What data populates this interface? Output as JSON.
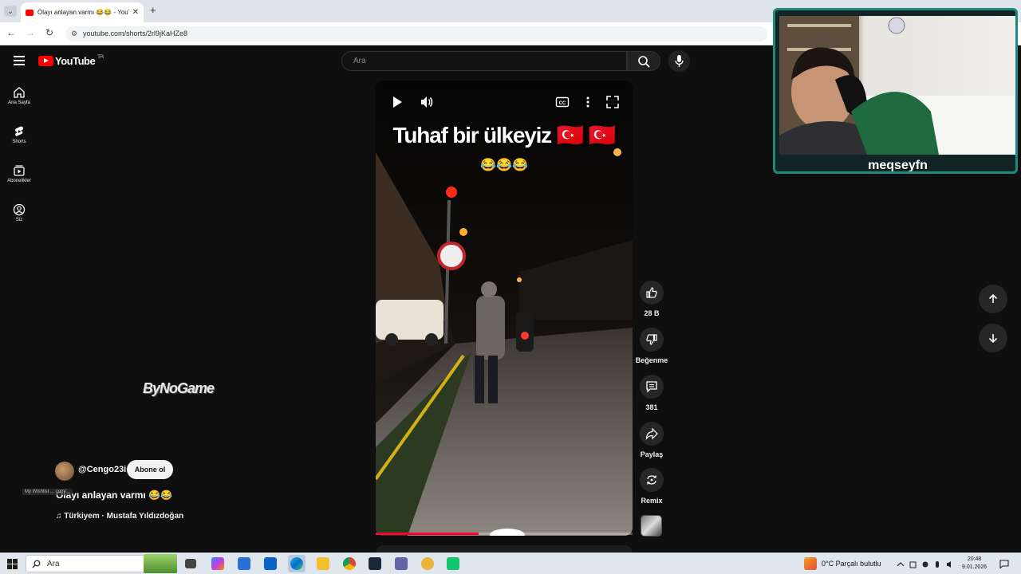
{
  "browser": {
    "tab_title": "Olayı anlayan varmı 😂😂 - YouTube",
    "url": "youtube.com/shorts/2rl9jKaHZe8",
    "new_tab": "+",
    "close": "✕",
    "tab_menu": "⌄"
  },
  "youtube": {
    "logo_text": "YouTube",
    "country_code": "TR",
    "search_placeholder": "Ara",
    "sidebar": [
      {
        "label": "Ana Sayfa",
        "icon": "home-icon"
      },
      {
        "label": "Shorts",
        "icon": "shorts-icon"
      },
      {
        "label": "Abonelikler",
        "icon": "subscriptions-icon"
      },
      {
        "label": "Siz",
        "icon": "you-icon"
      }
    ],
    "video": {
      "caption": "Tuhaf bir ülkeyiz 🇹🇷 🇹🇷",
      "emojis": "😂😂😂",
      "progress": 0.4
    },
    "actions": {
      "likes": "28 B",
      "dislike": "Beğenme",
      "comments": "381",
      "share": "Paylaş",
      "remix": "Remix"
    },
    "channel": {
      "handle": "@Cengo23i",
      "subscribe": "Abone ol"
    },
    "title": "Olayı anlayan varmı 😂😂",
    "music": "♫ Türkiyem · Mustafa Yıldızdoğan",
    "watermark": "My Wishlist ... com/...",
    "bygame_logo": "ByNoGame"
  },
  "webcam": {
    "name": "meqseyfn"
  },
  "taskbar": {
    "search_placeholder": "Ara",
    "weather": "0°C  Parçalı bulutlu",
    "time": "20:48",
    "date": "9.01.2026"
  },
  "colors": {
    "yt_red": "#ff0000",
    "progress_red": "#ff0033",
    "background": "#0f0f0f",
    "cam_border": "#1b8a7a"
  }
}
